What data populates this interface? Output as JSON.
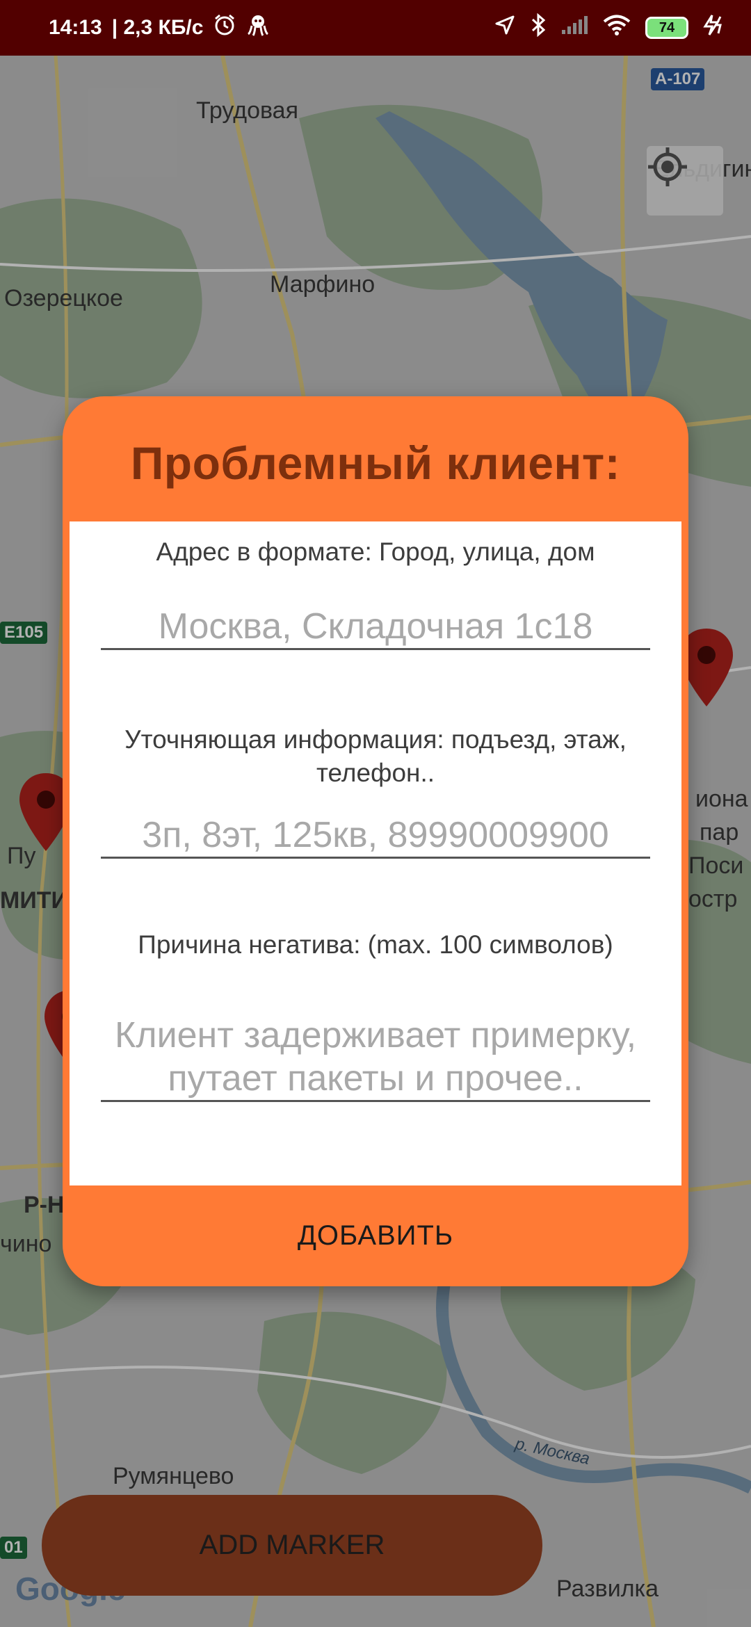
{
  "status_bar": {
    "time": "14:13",
    "speed": "| 2,3 КБ/с",
    "battery": "74",
    "icons": [
      "alarm-icon",
      "octopus-icon",
      "location-arrow-icon",
      "bluetooth-icon",
      "signal-icon",
      "wifi-icon",
      "battery-icon",
      "charging-icon"
    ]
  },
  "map": {
    "labels": {
      "trudovaya": "Трудовая",
      "marfino": "Марфино",
      "ozeretskoe": "Озерецкое",
      "eldigino": "Ельдигин",
      "rumyantsevo": "Румянцево",
      "razvilka": "Развилка",
      "moskva_river": "р. Москва",
      "pu": "Пу",
      "miti": "МИТИ",
      "r_n": "Р-Н",
      "chino": "чино",
      "iona": "иона",
      "par": "пар",
      "posi": "Поси",
      "ostr": "остр",
      "google": "Google"
    },
    "road_badges": {
      "a107": "А-107",
      "e105": "E105",
      "b01": "01"
    },
    "colors": {
      "land": "#c8c8c8",
      "water": "#7e9bb2",
      "park": "#9fb49a",
      "road": "#e2cf83",
      "pin": "#b3231d"
    }
  },
  "dialog": {
    "title": "Проблемный клиент:",
    "address_label": "Адрес в формате: Город, улица, дом",
    "address_placeholder": "Москва, Складочная 1с18",
    "details_label": "Уточняющая информация: подъезд, этаж, телефон..",
    "details_placeholder": "3п, 8эт, 125кв, 89990009900",
    "reason_label": "Причина негатива: (max. 100 символов)",
    "reason_placeholder": "Клиент задерживает примерку, путает пакеты и прочее..",
    "add_button": "ДОБАВИТЬ",
    "accent_color": "#ff7a35"
  },
  "add_marker_button": "ADD MARKER"
}
